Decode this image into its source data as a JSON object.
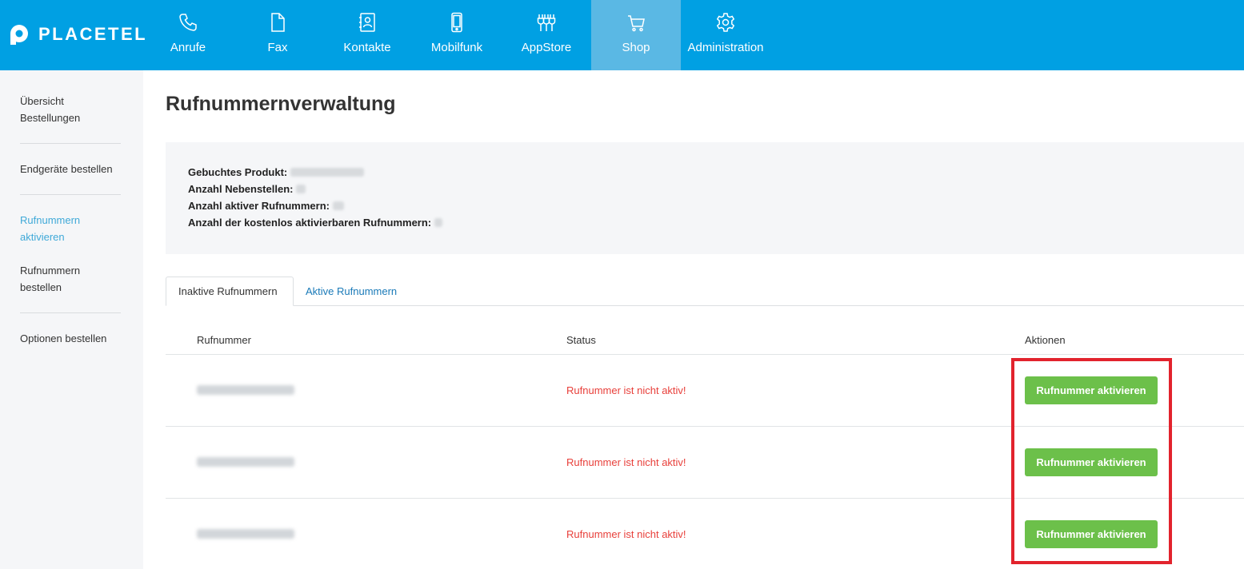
{
  "brand": {
    "name": "PLACETEL"
  },
  "nav": [
    {
      "label": "Anrufe",
      "icon": "phone-icon",
      "active": false
    },
    {
      "label": "Fax",
      "icon": "document-icon",
      "active": false
    },
    {
      "label": "Kontakte",
      "icon": "address-book-icon",
      "active": false
    },
    {
      "label": "Mobilfunk",
      "icon": "mobile-phone-icon",
      "active": false
    },
    {
      "label": "AppStore",
      "icon": "plugins-icon",
      "active": false
    },
    {
      "label": "Shop",
      "icon": "cart-icon",
      "active": true
    },
    {
      "label": "Administration",
      "icon": "gear-icon",
      "active": false
    }
  ],
  "sidebar": {
    "items": [
      {
        "label_line1": "Übersicht",
        "label_line2": "Bestellungen",
        "active": false
      },
      {
        "label_line1": "Endgeräte bestellen",
        "label_line2": "",
        "active": false
      },
      {
        "label_line1": "Rufnummern",
        "label_line2": "aktivieren",
        "active": true
      },
      {
        "label_line1": "Rufnummern",
        "label_line2": "bestellen",
        "active": false
      },
      {
        "label_line1": "Optionen bestellen",
        "label_line2": "",
        "active": false
      }
    ]
  },
  "page": {
    "title": "Rufnummernverwaltung"
  },
  "info": {
    "booked_product_label": "Gebuchtes Produkt:",
    "extensions_label": "Anzahl Nebenstellen:",
    "active_numbers_label": "Anzahl aktiver Rufnummern:",
    "free_numbers_label": "Anzahl der kostenlos aktivierbaren Rufnummern:"
  },
  "tabs": [
    {
      "label": "Inaktive Rufnummern",
      "active": true
    },
    {
      "label": "Aktive Rufnummern",
      "active": false
    }
  ],
  "table": {
    "headers": {
      "number": "Rufnummer",
      "status": "Status",
      "actions": "Aktionen"
    },
    "rows": [
      {
        "status": "Rufnummer ist nicht aktiv!",
        "action": "Rufnummer aktivieren"
      },
      {
        "status": "Rufnummer ist nicht aktiv!",
        "action": "Rufnummer aktivieren"
      },
      {
        "status": "Rufnummer ist nicht aktiv!",
        "action": "Rufnummer aktivieren"
      }
    ]
  },
  "colors": {
    "topbar": "#00a0e3",
    "nav_active": "#5ab8e4",
    "sidebar_active": "#3fa9d8",
    "status_error": "#e8403b",
    "action_button": "#6cc04a",
    "highlight": "#e2232d"
  }
}
